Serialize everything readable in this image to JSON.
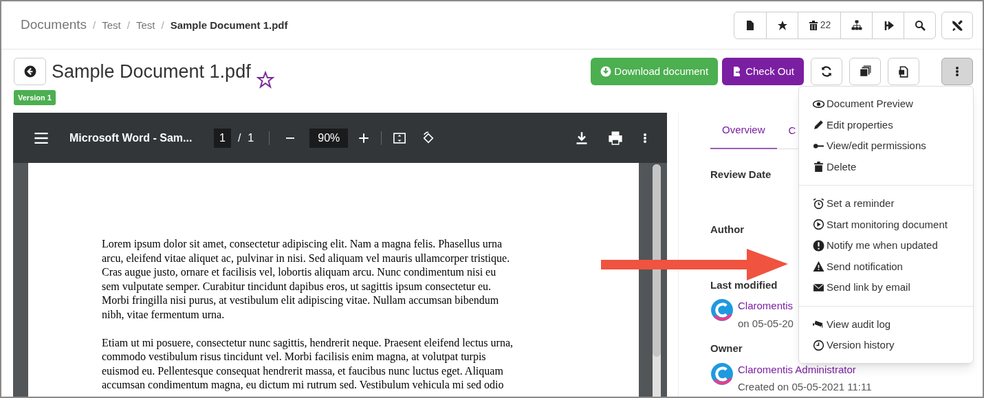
{
  "breadcrumb": [
    "Documents",
    "Test",
    "Test",
    "Sample Document 1.pdf"
  ],
  "breadcrumb_separator": "/",
  "toolbar": {
    "trash_count": "22"
  },
  "title": "Sample Document 1.pdf",
  "favorite": false,
  "version": "Version 1",
  "actions": {
    "download": "Download document",
    "checkout": "Check Out"
  },
  "menu": {
    "open": true,
    "groups": [
      [
        "Document Preview",
        "Edit properties",
        "View/edit permissions",
        "Delete"
      ],
      [
        "Set a reminder",
        "Start monitoring document",
        "Notify me when updated",
        "Send notification",
        "Send link by email"
      ],
      [
        "View audit log",
        "Version history"
      ]
    ]
  },
  "viewer": {
    "file_title": "Microsoft Word - Sam...",
    "page": "1",
    "page_separator": "/",
    "pages": "1",
    "zoom": "90%",
    "paragraphs": [
      [
        "Lorem ipsum dolor sit amet, consectetur adipiscing elit. Nam a magna felis. Phasellus urna",
        "arcu, eleifend vitae aliquet ac, pulvinar in nisi. Sed aliquam vel mauris ullamcorper tristique.",
        "Cras augue justo, ornare et facilisis vel, lobortis aliquam arcu. Nunc condimentum nisi eu",
        "sem vulputate semper. Curabitur tincidunt dapibus eros, ut sagittis ipsum consectetur eu.",
        "Morbi fringilla nisi purus, at vestibulum elit adipiscing vitae. Nullam accumsan bibendum",
        "nibh, vitae fermentum urna."
      ],
      [
        "Etiam ut mi posuere, consectetur nunc sagittis, hendrerit neque. Praesent eleifend lectus urna,",
        "commodo vestibulum risus tincidunt vel. Morbi facilisis enim magna, at volutpat turpis",
        "euismod eu. Pellentesque consequat hendrerit massa, et faucibus nunc luctus eget. Aliquam",
        "accumsan condimentum magna, eu dictum mi rutrum sed. Vestibulum vehicula mi sed odio"
      ]
    ]
  },
  "tabs": [
    {
      "label": "Overview",
      "selected": true
    },
    {
      "label": "C",
      "selected": false
    }
  ],
  "properties": [
    {
      "label": "Review Date"
    },
    {
      "label": "Author"
    },
    {
      "label": "Last modified",
      "user": "Claromentis",
      "date": "on 05-05-20"
    },
    {
      "label": "Owner",
      "user": "Claromentis Administrator",
      "date": "Created on 05-05-2021 11:11"
    }
  ]
}
